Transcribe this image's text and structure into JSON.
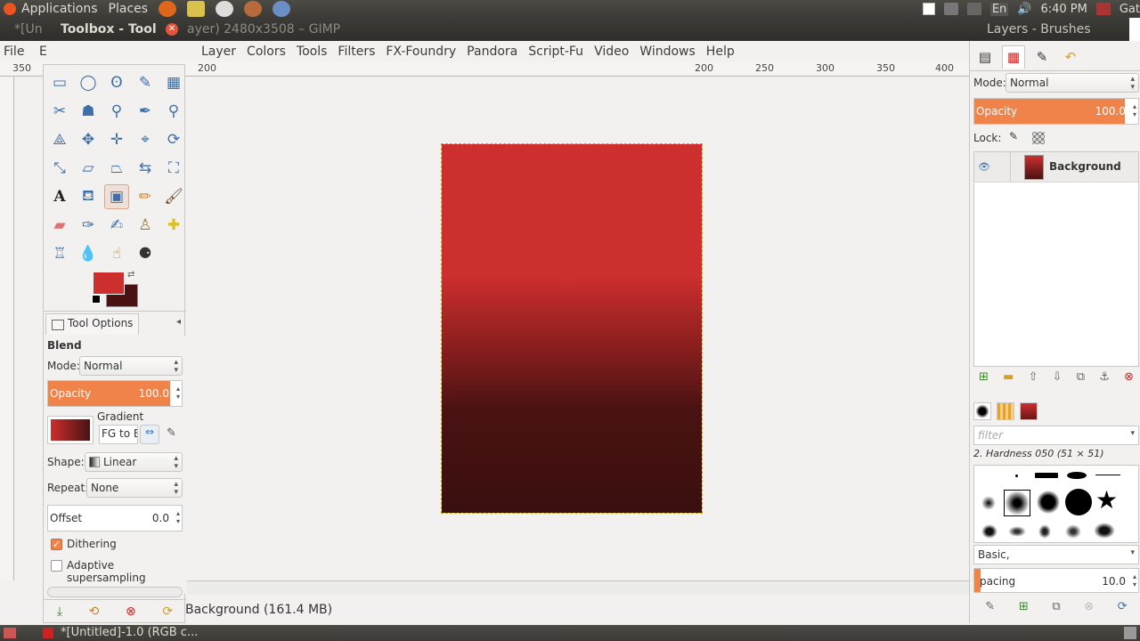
{
  "top_panel": {
    "applications": "Applications",
    "places": "Places",
    "keyboard": "En",
    "clock": "6:40 PM",
    "user": "Gat"
  },
  "titlebar": {
    "left_title": "*[Un",
    "toolbox_title": "Toolbox - Tool",
    "main_title": "ayer) 2480x3508 – GIMP",
    "dock_title": "Layers - Brushes"
  },
  "menubar": {
    "file": "File",
    "edit_fragment": "E",
    "items": [
      "Layer",
      "Colors",
      "Tools",
      "Filters",
      "FX-Foundry",
      "Pandora",
      "Script-Fu",
      "Video",
      "Windows",
      "Help"
    ]
  },
  "ruler": {
    "left_start": "350",
    "labels": [
      "200",
      "250",
      "300",
      "350",
      "400"
    ]
  },
  "toolbox": {
    "tools": [
      "rect-select",
      "ellipse-select",
      "free-select",
      "fuzzy-select",
      "color-select",
      "scissors-select",
      "foreground-select",
      "paths",
      "color-picker",
      "zoom",
      "measure",
      "move",
      "align",
      "crop",
      "rotate",
      "scale",
      "shear",
      "perspective",
      "flip",
      "cage",
      "text",
      "bucket-fill",
      "blend",
      "pencil",
      "paintbrush",
      "eraser",
      "airbrush",
      "ink",
      "clone",
      "heal",
      "perspective-clone",
      "blur",
      "smudge",
      "dodge-burn"
    ],
    "fg_color": "#cd2e2e",
    "bg_color": "#4a1212"
  },
  "tool_options": {
    "tab_label": "Tool Options",
    "heading": "Blend",
    "mode_label": "Mode:",
    "mode_value": "Normal",
    "opacity_label": "Opacity",
    "opacity_value": "100.0",
    "gradient_label": "Gradient",
    "gradient_name": "FG to B",
    "shape_label": "Shape:",
    "shape_value": "Linear",
    "repeat_label": "Repeat:",
    "repeat_value": "None",
    "offset_label": "Offset",
    "offset_value": "0.0",
    "dithering_label": "Dithering",
    "adaptive_label": "Adaptive supersampling"
  },
  "status": {
    "text": "Background (161.4 MB)"
  },
  "dock": {
    "mode_label": "Mode:",
    "mode_value": "Normal",
    "opacity_label": "Opacity",
    "opacity_value": "100.0",
    "lock_label": "Lock:",
    "layer_name": "Background",
    "filter_placeholder": "filter",
    "brush_name": "2. Hardness 050 (51 × 51)",
    "preset": "Basic,",
    "spacing_label": "pacing",
    "spacing_value": "10.0"
  },
  "taskbar": {
    "task_label": "*[Untitled]-1.0 (RGB c..."
  }
}
